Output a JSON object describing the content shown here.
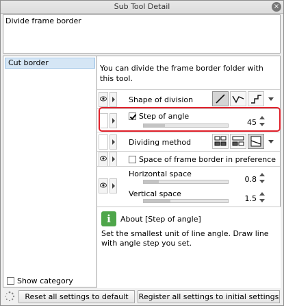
{
  "window": {
    "title": "Sub Tool Detail",
    "close_label": "×"
  },
  "tool_name": "Divide frame border",
  "categories": {
    "items": [
      {
        "label": "Cut border",
        "selected": true
      }
    ],
    "show_category_label": "Show category",
    "show_category_checked": false
  },
  "description": "You can divide the frame border folder with this tool.",
  "properties": {
    "shape_of_division": {
      "label": "Shape of division",
      "options": [
        "straight-line-icon",
        "polyline-icon",
        "step-line-icon"
      ],
      "selected": 0
    },
    "step_of_angle": {
      "label": "Step of angle",
      "checked": true,
      "value": "45",
      "slider_fraction": 0.25
    },
    "dividing_method": {
      "label": "Dividing method",
      "options": [
        "divide-both-icon",
        "divide-one-icon",
        "divide-trim-icon"
      ],
      "selected": 2
    },
    "space_in_preference": {
      "label": "Space of frame border in preference",
      "checked": false
    },
    "horizontal_space": {
      "label": "Horizontal space",
      "value": "0.8",
      "slider_fraction": 0.18
    },
    "vertical_space": {
      "label": "Vertical space",
      "value": "1.5",
      "slider_fraction": 0.32
    }
  },
  "about": {
    "title": "About [Step of angle]",
    "text": "Set the smallest unit of line angle. Draw line with angle step you set."
  },
  "footer": {
    "reset_label": "Reset all settings to default",
    "register_label": "Register all settings to initial settings"
  },
  "colors": {
    "highlight": "#e0212b",
    "selection": "#d5e6f5",
    "info_icon": "#4ea64a"
  }
}
